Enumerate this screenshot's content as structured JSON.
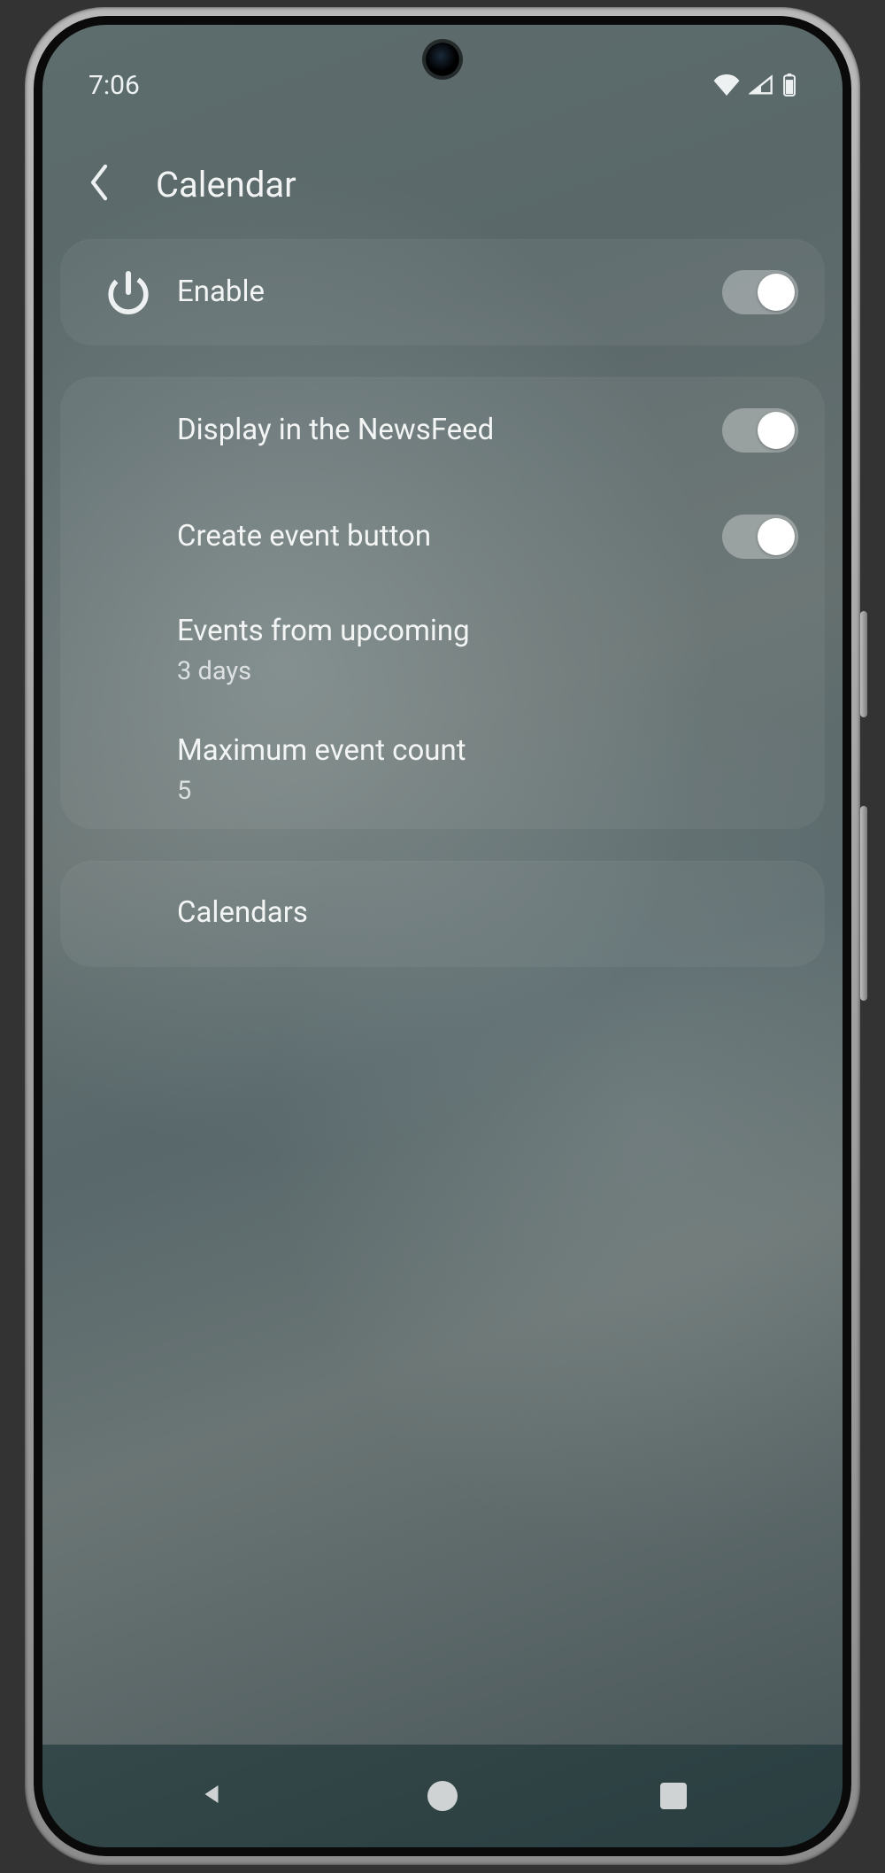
{
  "statusbar": {
    "time": "7:06"
  },
  "header": {
    "title": "Calendar"
  },
  "enable": {
    "label": "Enable",
    "on": true
  },
  "settings": {
    "display_newsfeed": {
      "label": "Display in the NewsFeed",
      "on": true
    },
    "create_event_button": {
      "label": "Create event button",
      "on": true
    },
    "events_upcoming": {
      "label": "Events from upcoming",
      "value": "3 days"
    },
    "max_event_count": {
      "label": "Maximum event count",
      "value": "5"
    }
  },
  "calendars": {
    "label": "Calendars"
  }
}
